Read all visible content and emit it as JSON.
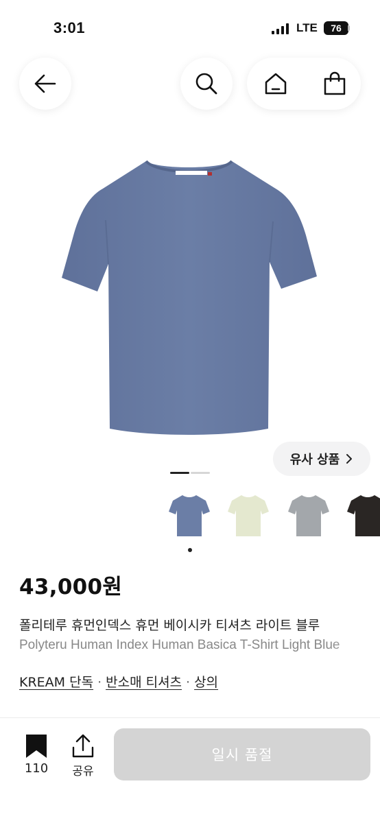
{
  "status_bar": {
    "time": "3:01",
    "network": "LTE",
    "battery": "76"
  },
  "header": {
    "back_icon": "arrow-left-icon",
    "search_icon": "search-icon",
    "home_icon": "home-icon",
    "shop_icon": "shopping-bag-icon"
  },
  "product_image": {
    "color": "#6b7ea6",
    "neck_label": "HUMANINDEX"
  },
  "similar_products": {
    "label": "유사 상품",
    "icon": "chevron-right-icon"
  },
  "carousel": {
    "current": 1,
    "total": 2
  },
  "color_options": [
    {
      "color": "#6b7ea6",
      "selected": true
    },
    {
      "color": "#e4e8cf",
      "selected": false
    },
    {
      "color": "#a3a7ab",
      "selected": false
    },
    {
      "color": "#2a2624",
      "selected": false
    }
  ],
  "product": {
    "price": "43,000원",
    "title_ko": "폴리테루 휴먼인덱스 휴먼 베이시카 티셔츠 라이트 블루",
    "title_en": "Polyteru Human Index Human Basica T-Shirt Light Blue",
    "tags": [
      "KREAM 단독",
      "반소매 티셔츠",
      "상의"
    ],
    "tag_separator": "·"
  },
  "bottom_bar": {
    "bookmark_icon": "bookmark-icon",
    "bookmark_count": "110",
    "share_icon": "share-icon",
    "share_label": "공유",
    "action_label": "일시 품절",
    "action_color": "#d4d4d4"
  }
}
